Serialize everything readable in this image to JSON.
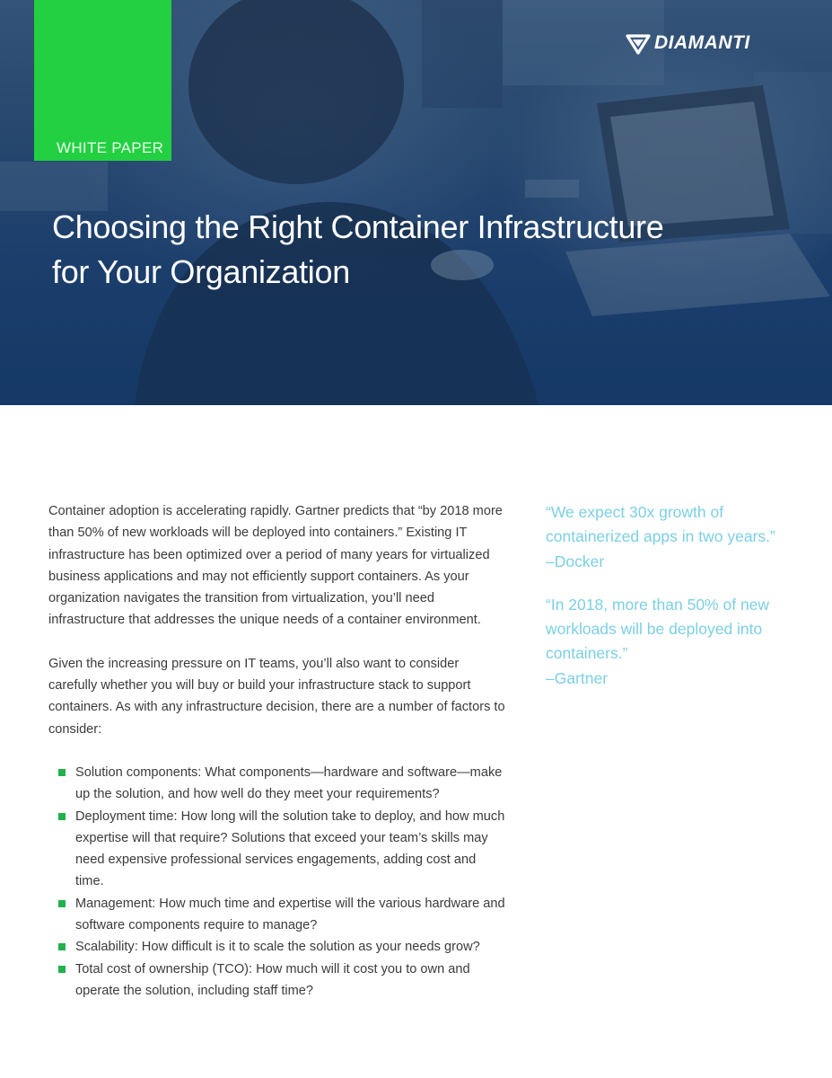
{
  "header": {
    "badge_label": "WHITE PAPER",
    "logo_text": "DIAMANTI",
    "title_lines": [
      "Choosing the Right Container Infrastructure",
      "for Your Organization"
    ]
  },
  "body": {
    "paragraphs": [
      "Container adoption is accelerating rapidly. Gartner predicts that “by 2018 more than 50% of new workloads will be deployed into containers.” Existing IT infrastructure has been optimized over a period of many years for virtualized business applications and may not efficiently support containers. As your organization navigates the transition from virtualization, you’ll need infrastructure that addresses the unique needs of a container environment.",
      "Given the increasing pressure on IT teams, you’ll also want to consider carefully whether you will buy or build your infrastructure stack to support containers. As with any infrastructure decision, there are a number of factors to consider:"
    ],
    "bullets": [
      "Solution components: What components—hardware and software—make up the solution, and how well do they meet your requirements?",
      "Deployment time: How long will the solution take to deploy, and how much expertise will that require? Solutions that exceed your team’s skills may need expensive professional services engagements, adding cost and time.",
      "Management: How much time and expertise will the various hardware and software components require to manage?",
      "Scalability: How difficult is it to scale the solution as your needs grow?",
      "Total cost of ownership (TCO): How much will it cost you to own and operate the solution, including staff time?"
    ]
  },
  "quotes": [
    {
      "text": "“We expect 30x growth of containerized apps in two years.”",
      "source": "–Docker"
    },
    {
      "text": "“In 2018, more than 50% of new workloads will be deployed into containers.”",
      "source": "–Gartner"
    }
  ],
  "colors": {
    "accent_green": "#22d042",
    "bullet_green": "#22b14c",
    "quote_blue": "#7ccfe3",
    "hero_blue": "#1e4170"
  },
  "icons": {
    "logo_mark": "diamond-logo-icon",
    "bullet": "square-bullet-icon"
  }
}
